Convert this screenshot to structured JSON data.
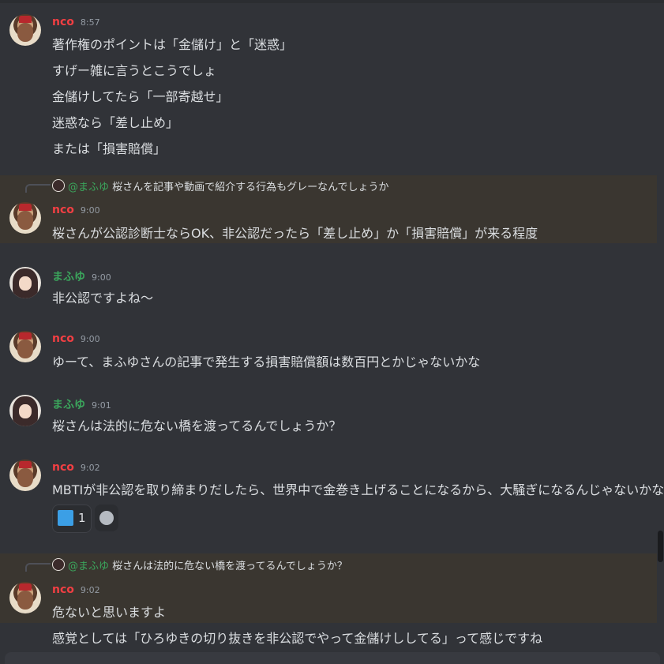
{
  "messages": [
    {
      "author": "nco",
      "time": "8:57",
      "lines": [
        "著作権のポイントは「金儲け」と「迷惑」",
        "すげー雑に言うとこうでしょ",
        "金儲けしてたら「一部寄越せ」",
        "迷惑なら「差し止め」",
        "または「損害賠償」"
      ]
    },
    {
      "reply_to": {
        "mention": "@まふゆ",
        "text": "桜さんを記事や動画で紹介する行為もグレーなんでしょうか"
      },
      "author": "nco",
      "time": "9:00",
      "lines": [
        "桜さんが公認診断士ならOK、非公認だったら「差し止め」か「損害賠償」が来る程度"
      ]
    },
    {
      "author": "まふゆ",
      "time": "9:00",
      "lines": [
        "非公認ですよね～"
      ]
    },
    {
      "author": "nco",
      "time": "9:00",
      "lines": [
        "ゆーて、まふゆさんの記事で発生する損害賠償額は数百円とかじゃないかな"
      ]
    },
    {
      "author": "まふゆ",
      "time": "9:01",
      "lines": [
        "桜さんは法的に危ない橋を渡ってるんでしょうか？"
      ]
    },
    {
      "author": "nco",
      "time": "9:02",
      "lines": [
        "MBTIが非公認を取り締まりだしたら、世界中で金巻き上げることになるから、大騒ぎになるんじゃないかな"
      ],
      "reaction": {
        "emoji": "custom-emoji",
        "count": "1"
      }
    },
    {
      "reply_to": {
        "mention": "@まふゆ",
        "text": "桜さんは法的に危ない橋を渡ってるんでしょうか？"
      },
      "author": "nco",
      "time": "9:02",
      "lines": [
        "危ないと思いますよ",
        "感覚としては「ひろゆきの切り抜きを非公認でやって金儲けししてる」って感じですね"
      ]
    }
  ],
  "colors": {
    "background": "#313338",
    "author_nco": "#f23f43",
    "author_mafuyu": "#3ba55c",
    "highlight": "#3a3630"
  }
}
